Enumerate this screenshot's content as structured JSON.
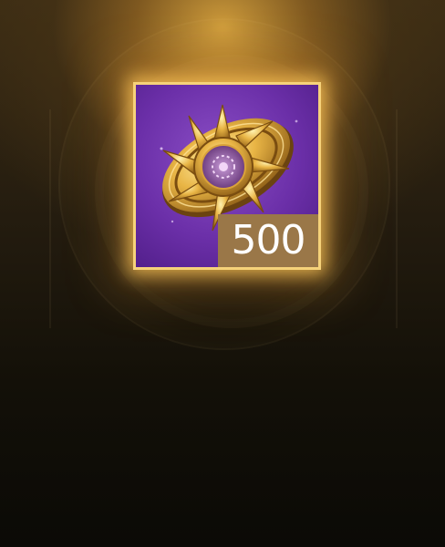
{
  "reward": {
    "item_icon": "golden-sun-emblem-icon",
    "quantity": "500"
  },
  "colors": {
    "frame_border": "#f6d27a",
    "tile_background": "#6b2fa8",
    "badge_background": "#9a7748",
    "badge_text": "#ffffff",
    "glow": "#ffc85a"
  }
}
